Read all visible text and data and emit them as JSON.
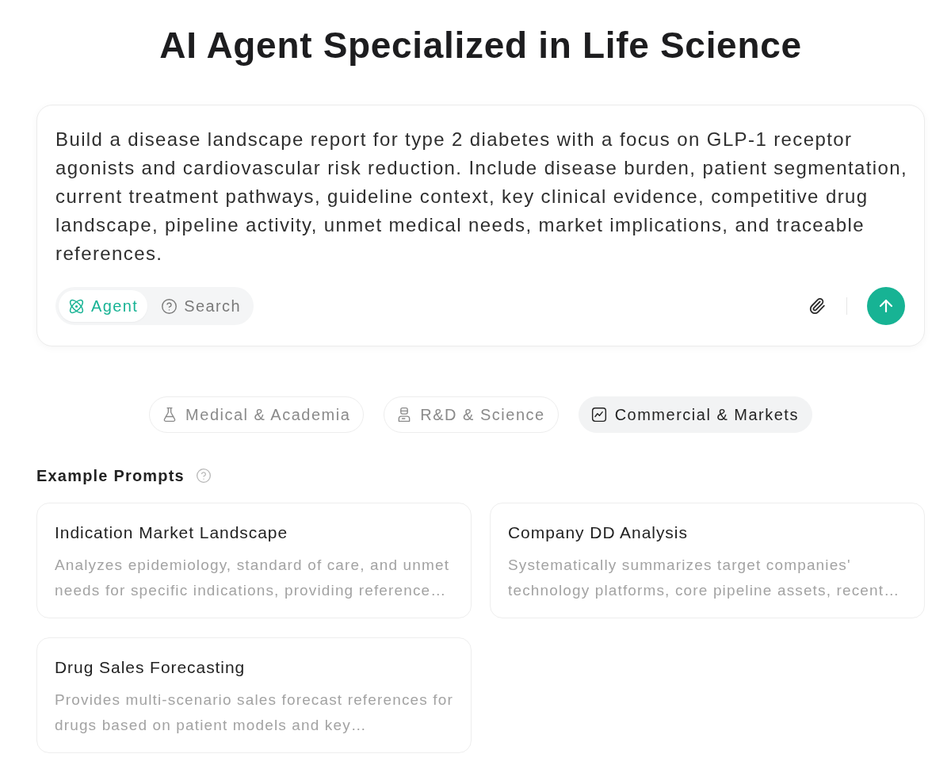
{
  "title": "AI Agent Specialized in Life Science",
  "prompt_box": {
    "value": "Build a disease landscape report for type 2 diabetes with a focus on GLP-1 receptor agonists and cardiovascular risk reduction. Include disease burden, patient segmentation, current treatment pathways, guideline context, key clinical evidence, competitive drug landscape, pipeline activity, unmet medical needs, market implications, and traceable references.",
    "modes": [
      {
        "label": "Agent",
        "kind": "agent",
        "selected": true
      },
      {
        "label": "Search",
        "kind": "search",
        "selected": false
      }
    ]
  },
  "categories": [
    {
      "label": "Medical & Academia",
      "kind": "medical",
      "selected": false
    },
    {
      "label": "R&D & Science",
      "kind": "research",
      "selected": false
    },
    {
      "label": "Commercial & Markets",
      "kind": "commercial",
      "selected": true
    }
  ],
  "examples": {
    "heading": "Example Prompts",
    "cards": [
      {
        "title": "Indication Market Landscape",
        "description": "Analyzes epidemiology, standard of care, and unmet needs for specific indications, providing reference…"
      },
      {
        "title": "Company DD Analysis",
        "description": "Systematically summarizes target companies' technology platforms, core pipeline assets, recent…"
      },
      {
        "title": "Drug Sales Forecasting",
        "description": "Provides multi-scenario sales forecast references for drugs based on patient models and key…"
      }
    ]
  }
}
